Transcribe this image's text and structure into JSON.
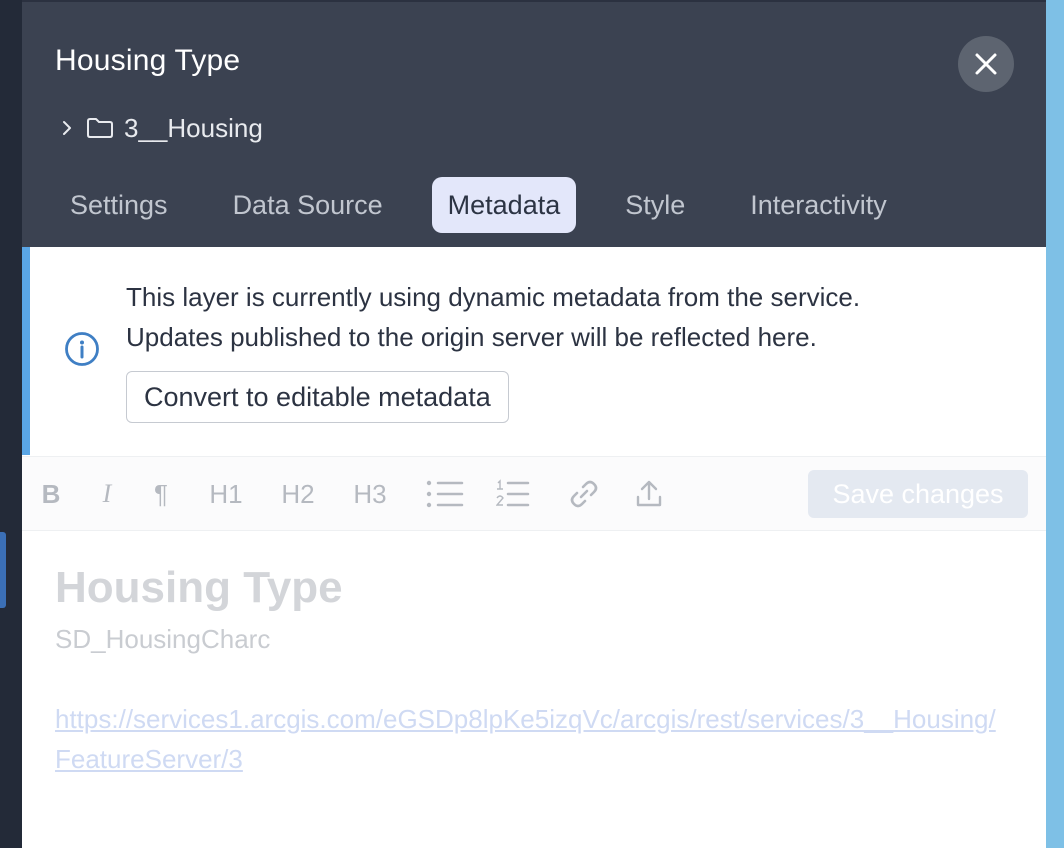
{
  "layer": {
    "title": "Housing Type",
    "breadcrumb_folder": "3__Housing"
  },
  "tabs": [
    {
      "label": "Settings",
      "active": false
    },
    {
      "label": "Data Source",
      "active": false
    },
    {
      "label": "Metadata",
      "active": true
    },
    {
      "label": "Style",
      "active": false
    },
    {
      "label": "Interactivity",
      "active": false
    }
  ],
  "info_banner": {
    "line1": "This layer is currently using dynamic metadata from the service.",
    "line2": "Updates published to the origin server will be reflected here.",
    "convert_button": "Convert to editable metadata"
  },
  "toolbar": {
    "bold": "B",
    "italic": "I",
    "paragraph": "¶",
    "h1": "H1",
    "h2": "H2",
    "h3": "H3",
    "save_button": "Save changes"
  },
  "editor": {
    "title": "Housing Type",
    "subtitle": "SD_HousingCharc",
    "link": "https://services1.arcgis.com/eGSDp8lpKe5izqVc/arcgis/rest/services/3__Housing/FeatureServer/3"
  },
  "icons": {
    "close": "close-icon",
    "chevron": "chevron-right-icon",
    "folder": "folder-icon",
    "info": "info-icon",
    "bulleted_list": "bulleted-list-icon",
    "numbered_list": "numbered-list-icon",
    "link": "link-icon",
    "upload": "upload-icon"
  },
  "colors": {
    "header_bg": "#3b4251",
    "active_tab_bg": "#e3e7fa",
    "info_accent": "#5aa6e6",
    "info_icon": "#3f7fc4",
    "right_rail": "#7ec0e6"
  }
}
